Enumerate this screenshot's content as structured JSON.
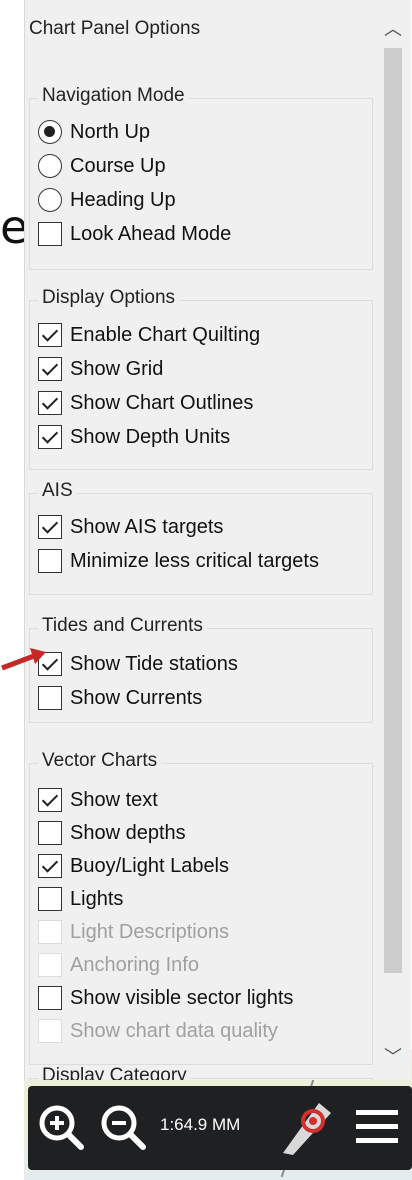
{
  "background": {
    "partial_text": "el"
  },
  "panel": {
    "title": "Chart Panel Options",
    "scroll_up_icon": "chevron-up-icon",
    "scroll_down_icon": "chevron-down-icon"
  },
  "navigation": {
    "title": "Navigation Mode",
    "options": [
      {
        "label": "North Up",
        "selected": true
      },
      {
        "label": "Course Up",
        "selected": false
      },
      {
        "label": "Heading Up",
        "selected": false
      }
    ],
    "look_ahead": {
      "label": "Look Ahead Mode",
      "checked": false
    }
  },
  "display": {
    "title": "Display Options",
    "items": [
      {
        "label": "Enable Chart Quilting",
        "checked": true
      },
      {
        "label": "Show Grid",
        "checked": true
      },
      {
        "label": "Show Chart Outlines",
        "checked": true
      },
      {
        "label": "Show Depth Units",
        "checked": true
      }
    ]
  },
  "ais": {
    "title": "AIS",
    "items": [
      {
        "label": "Show AIS targets",
        "checked": true
      },
      {
        "label": "Minimize less critical targets",
        "checked": false
      }
    ]
  },
  "tides": {
    "title": "Tides and Currents",
    "items": [
      {
        "label": "Show Tide stations",
        "checked": true
      },
      {
        "label": "Show Currents",
        "checked": false
      }
    ]
  },
  "vector": {
    "title": "Vector Charts",
    "items": [
      {
        "label": "Show text",
        "checked": true,
        "enabled": true
      },
      {
        "label": "Show depths",
        "checked": false,
        "enabled": true
      },
      {
        "label": "Buoy/Light Labels",
        "checked": true,
        "enabled": true
      },
      {
        "label": "Lights",
        "checked": false,
        "enabled": true
      },
      {
        "label": "Light Descriptions",
        "checked": false,
        "enabled": false
      },
      {
        "label": "Anchoring Info",
        "checked": false,
        "enabled": false
      },
      {
        "label": "Show visible sector lights",
        "checked": false,
        "enabled": true
      },
      {
        "label": "Show chart data quality",
        "checked": false,
        "enabled": false
      }
    ]
  },
  "display_category": {
    "title": "Display Category"
  },
  "toolbar": {
    "zoom_in_icon": "zoom-in-icon",
    "zoom_out_icon": "zoom-out-icon",
    "scale": "1:64.9 MM",
    "compass_icon": "compass-icon",
    "menu_icon": "menu-icon"
  },
  "colors": {
    "panel_bg": "#f0f0f0",
    "toolbar_bg": "#1f2021",
    "annotation_arrow": "#c62828",
    "compass_red": "#d32f2f"
  }
}
